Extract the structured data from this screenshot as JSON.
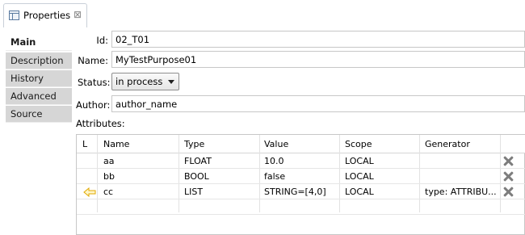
{
  "tab": {
    "title": "Properties",
    "close": "⊠"
  },
  "sidebar": {
    "items": [
      {
        "label": "Main"
      },
      {
        "label": "Description"
      },
      {
        "label": "History"
      },
      {
        "label": "Advanced"
      },
      {
        "label": "Source"
      }
    ]
  },
  "form": {
    "id_label": "Id:",
    "id_value": "02_T01",
    "name_label": "Name:",
    "name_value": "MyTestPurpose01",
    "status_label": "Status:",
    "status_value": "in process",
    "author_label": "Author:",
    "author_value": "author_name",
    "attributes_label": "Attributes:"
  },
  "attributes": {
    "columns": [
      "L",
      "Name",
      "Type",
      "Value",
      "Scope",
      "Generator"
    ],
    "rows": [
      {
        "link": "",
        "name": "aa",
        "type": "FLOAT",
        "value": "10.0",
        "scope": "LOCAL",
        "generator": ""
      },
      {
        "link": "",
        "name": "bb",
        "type": "BOOL",
        "value": "false",
        "scope": "LOCAL",
        "generator": ""
      },
      {
        "link": "arrow-left-icon",
        "name": "cc",
        "type": "LIST",
        "value": "STRING=[4,0]",
        "scope": "LOCAL",
        "generator": "type: ATTRIBU..."
      }
    ]
  },
  "colors": {
    "sidebar_bg": "#d6d6d6",
    "arrow": "#f5c400",
    "delete": "#7d7d7d"
  }
}
